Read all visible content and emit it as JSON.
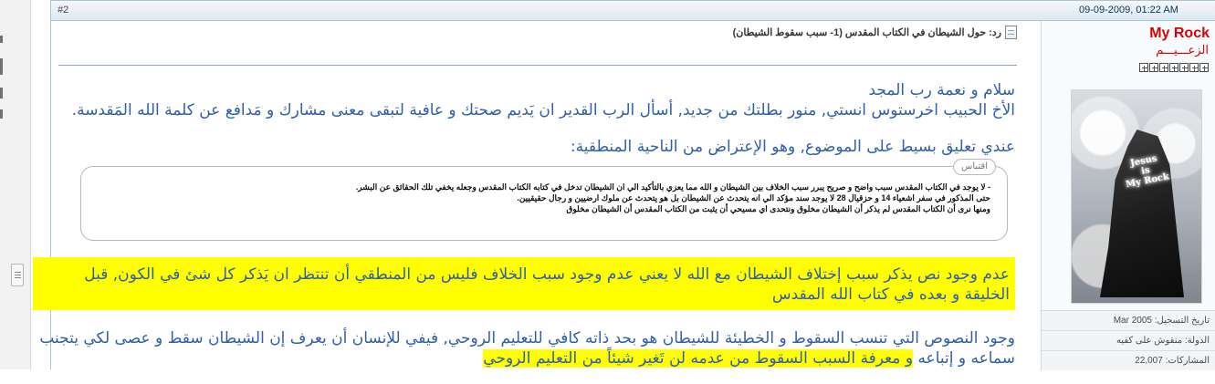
{
  "post": {
    "number": "#2",
    "date": "09-09-2009, 01:22 AM",
    "title": "رد: حول الشيطان في الكتاب المقدس (1- سبب سقوط الشيطان)"
  },
  "body": {
    "greeting": "سلام و نعمة رب المجد",
    "intro": "الأخ الحبيب اخرستوس انستي, منور بطلتك من جديد, أسأل الرب القدير ان يَديم صحتك و عافية لتبقى معنى مشارك و مَدافع عن كلمة الله المَقدسة.",
    "comment_intro": "عندي تعليق بسيط على الموضوع, وهو الإعتراض من الناحية المنطقية:",
    "quote": {
      "label": "اقتباس",
      "lines": [
        "- لا يوجد في الكتاب المقدس سبب واضح و صريح يبرر سبب الخلاف بين الشيطان و الله مما يعزي بالتأكيد الي ان الشيطان تدخل في كتابه الكتاب المقدس وجعله يخفي تلك الحقائق عن البشر.",
        "حتى المذكور في سفر اشعياء 14 و حزقيال 28 لا يوجد سند مؤكد الي انه يتحدث عن الشيطان بل هو يتحدث عن ملوك ارضيين و رجال حقيقيين.",
        "ومنها نرى أن الكتاب المقدس لم يذكر أن الشيطان مخلوق ونتحدى اي مسيحي أن يثبت من الكتاب المقدس أن الشيطان مخلوق"
      ]
    },
    "highlight": "عدم وجود نص يذكر سبب إختلاف الشيطان مع الله لا يعني عدم وجود سبب الخلاف فليس من المنطقي أن تنتظر ان يَذكر كل شئ في الكون, قبل الخليقة و بعده في كتاب الله المقدس",
    "final_start": "وجود النصوص التي تنسب السقوط و الخطيئة للشيطان هو بحد ذاته كافي للتعليم الروحي, فيفي للإنسان أن يعرف إن الشيطان سقط و عصى لكي يتجنب سماعه و إتباعه",
    "final_highlight": "و معرفة السبب السقوط من عدمه لن تَغير شيئاً من التعليم الروحي"
  },
  "sidebar": {
    "username": "My Rock",
    "rank": "الزعـــيـــم",
    "rank_icon_count": 7,
    "avatar_text": "Jesus\nis\nMy Rock",
    "meta": {
      "registration_label": "تاريخ التسجيل:",
      "registration_value": "Mar 2005",
      "country_label": "الدولة:",
      "country_value": "منقوش على كفيه",
      "posts_label": "المشاركات:",
      "posts_value": "22,007"
    }
  },
  "colors": {
    "body_text": "#2e5fa8",
    "highlight": "#ffff00",
    "username": "#d80000",
    "header_border": "#a9c5d8"
  }
}
